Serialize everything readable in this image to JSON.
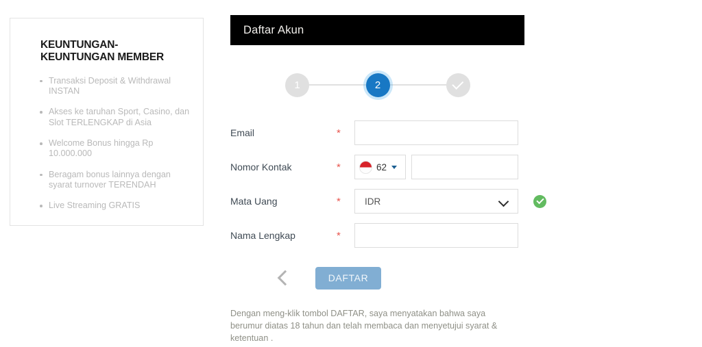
{
  "benefits": {
    "title": "KEUNTUNGAN-KEUNTUNGAN MEMBER",
    "items": [
      "Transaksi Deposit & Withdrawal INSTAN",
      "Akses ke taruhan Sport, Casino, dan Slot TERLENGKAP di Asia",
      "Welcome Bonus hingga Rp 10.000.000",
      "Beragam bonus lainnya dengan syarat turnover TERENDAH",
      "Live Streaming GRATIS"
    ]
  },
  "header": {
    "title": "Daftar Akun",
    "background": "#000000",
    "text_color": "#f0eeea"
  },
  "stepper": {
    "steps": [
      {
        "label": "1",
        "state": "inactive"
      },
      {
        "label": "2",
        "state": "active"
      },
      {
        "label": "",
        "state": "complete-icon"
      }
    ],
    "active_color": "#1878c4",
    "inactive_color": "#e0e0e0"
  },
  "form": {
    "required_mark": "*",
    "fields": {
      "email": {
        "label": "Email",
        "value": "",
        "placeholder": ""
      },
      "phone": {
        "label": "Nomor Kontak",
        "dial_code": "62",
        "flag": "indonesia-flag-icon",
        "value": "",
        "placeholder": ""
      },
      "currency": {
        "label": "Mata Uang",
        "selected": "IDR",
        "options": [
          "IDR"
        ],
        "validated": true,
        "valid_color": "#62bb60"
      },
      "fullname": {
        "label": "Nama Lengkap",
        "value": "",
        "placeholder": ""
      }
    }
  },
  "actions": {
    "back_icon": "chevron-left-icon",
    "submit_label": "DAFTAR",
    "submit_color": "#81aed3",
    "disclaimer": "Dengan meng-klik tombol DAFTAR, saya menyatakan bahwa saya berumur diatas 18 tahun dan telah membaca dan menyetujui syarat & ketentuan ."
  }
}
